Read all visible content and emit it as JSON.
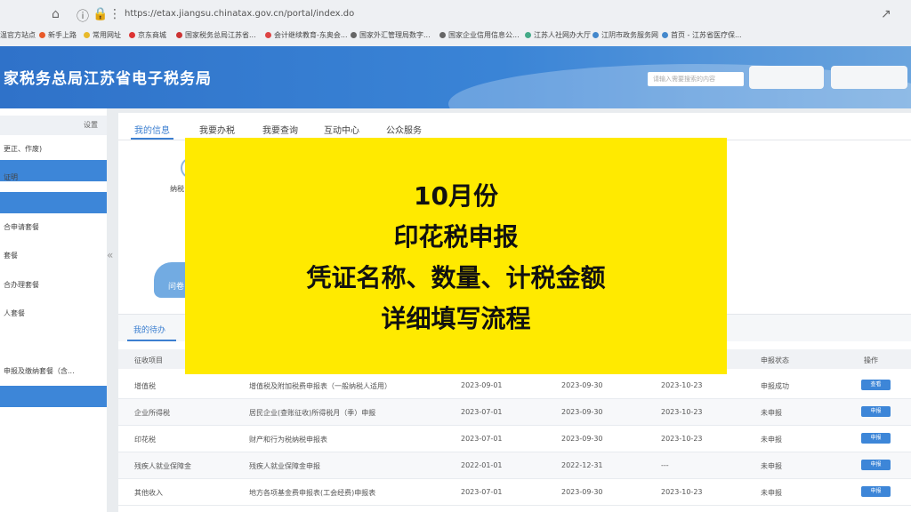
{
  "browser": {
    "url": "https://etax.jiangsu.chinatax.gov.cn/portal/index.do",
    "bookmarks": [
      "温官方站点",
      "新手上路",
      "常用网址",
      "京东商城",
      "国家税务总局江苏省...",
      "会计继续教育-东奥会...",
      "国家外汇管理局数字...",
      "国家企业信用信息公...",
      "江苏人社网办大厅",
      "江阴市政务服务网",
      "首页 - 江苏省医疗保..."
    ]
  },
  "header": {
    "title": "家税务总局江苏省电子税务局",
    "search_placeholder": "请输入需要搜索的内容"
  },
  "sidebar": {
    "settings_label": "设置",
    "items": [
      "更正、作废)",
      "证明",
      "合申请套餐",
      "套餐",
      "合办理套餐",
      "人套餐",
      "",
      "申报及缴纳套餐（含..."
    ]
  },
  "tabs": [
    "我的信息",
    "我要办税",
    "我要查询",
    "互动中心",
    "公众服务"
  ],
  "info_panel": {
    "taxpayer_label": "纳税",
    "cloud_label": "问卷"
  },
  "todo": {
    "tab_label": "我的待办",
    "columns": [
      "征收项目",
      "申报状态",
      "操作"
    ],
    "rows": [
      {
        "item": "增值税",
        "form": "增值税及附加税费申报表（一般纳税人适用）",
        "start": "2023-09-01",
        "end": "2023-09-30",
        "deadline": "2023-10-23",
        "status": "申报成功",
        "action": "查看"
      },
      {
        "item": "企业所得税",
        "form": "居民企业(查账征收)所得税月（季）申报",
        "start": "2023-07-01",
        "end": "2023-09-30",
        "deadline": "2023-10-23",
        "status": "未申报",
        "action": "申报"
      },
      {
        "item": "印花税",
        "form": "财产和行为税纳税申报表",
        "start": "2023-07-01",
        "end": "2023-09-30",
        "deadline": "2023-10-23",
        "status": "未申报",
        "action": "申报"
      },
      {
        "item": "残疾人就业保障金",
        "form": "残疾人就业保障金申报",
        "start": "2022-01-01",
        "end": "2022-12-31",
        "deadline": "---",
        "status": "未申报",
        "action": "申报"
      },
      {
        "item": "其他收入",
        "form": "地方各项基金费申报表(工会经费)申报表",
        "start": "2023-07-01",
        "end": "2023-09-30",
        "deadline": "2023-10-23",
        "status": "未申报",
        "action": "申报"
      }
    ]
  },
  "overlay": {
    "lines": [
      "10月份",
      "印花税申报",
      "凭证名称、数量、计税金额",
      "详细填写流程"
    ],
    "background": "#ffea00"
  }
}
